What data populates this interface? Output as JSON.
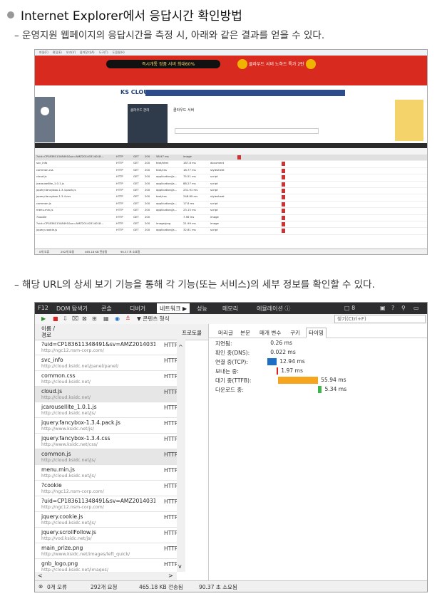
{
  "heading": "Internet Explorer에서 응답시간 확인방법",
  "desc1": "– 운영지원 웹페이지의 응답시간을 측정 시, 아래와 같은 결과를 얻을 수 있다.",
  "desc2": "– 해당 URL의 상세 보기 기능을 통해 각 기능(또는 서비스)의 세부 정보를 확인할 수 있다.",
  "shot1": {
    "banner_left": "즉시개통 정품 서버 최대60%",
    "banner_right": "클라우드 서버 노하드 특가 2탄",
    "logo": "KS CLOUD",
    "side_title": "클라우드 관리",
    "content_title": "클라우드 서버",
    "rows": [
      [
        "?uid=CP183611348491&sv=AMZ20140314018...",
        "HTTP",
        "GET",
        "200",
        "58.97 ms",
        "image"
      ],
      [
        "svc_info",
        "HTTP",
        "GET",
        "200",
        "text/html",
        "187.8 ms",
        "document"
      ],
      [
        "common.css",
        "HTTP",
        "GET",
        "200",
        "text/css",
        "18.77 ms",
        "stylesheet"
      ],
      [
        "cloud.js",
        "HTTP",
        "GET",
        "200",
        "application/ja...",
        "75.51 ms",
        "script"
      ],
      [
        "jcarousellite_1.0.1.js",
        "HTTP",
        "GET",
        "200",
        "application/ja...",
        "88.27 ms",
        "script"
      ],
      [
        "jquery.fancybox-1.3.4.pack.js",
        "HTTP",
        "GET",
        "200",
        "application/ja...",
        "231.91 ms",
        "script"
      ],
      [
        "jquery.fancybox-1.3.4.css",
        "HTTP",
        "GET",
        "200",
        "text/css",
        "248.89 ms",
        "stylesheet"
      ],
      [
        "common.js",
        "HTTP",
        "GET",
        "200",
        "application/ja...",
        "17.8 ms",
        "script"
      ],
      [
        "menu.min.js",
        "HTTP",
        "GET",
        "200",
        "application/ja...",
        "23.15 ms",
        "script"
      ],
      [
        "?cookie",
        "HTTP",
        "GET",
        "200",
        "",
        "7.56 ms",
        "image"
      ],
      [
        "?uid=CP183611348491&sv=AMZ20140314018...",
        "HTTP",
        "GET",
        "200",
        "image/png",
        "21.99 ms",
        "image"
      ],
      [
        "jquery.cookie.js",
        "HTTP",
        "GET",
        "200",
        "application/ja...",
        "32.81 ms",
        "script"
      ]
    ],
    "status": [
      "0개 오류",
      "292개 요청",
      "465.18 KB 전송됨",
      "90.37 초 소요됨"
    ]
  },
  "shot2": {
    "topbar": {
      "f12": "F12",
      "tabs": [
        "DOM 탐색기",
        "콘솔",
        "디버거",
        "네트워크 ▶",
        "성능",
        "메모리",
        "에뮬레이션 ⓘ"
      ],
      "device": "□ 8"
    },
    "toolbar": {
      "filter": "▼ 콘텐츠 형식",
      "search_placeholder": "찾기(Ctrl+F)"
    },
    "list_header": {
      "name": "이름 /",
      "path": "경로",
      "protocol": "프로토콜"
    },
    "rows": [
      {
        "name": "?uid=CP183611348491&sv=AMZ20140314018&url...",
        "url": "http://ngc12.nsm-corp.com/",
        "protocol": "HTTP"
      },
      {
        "name": "svc_info",
        "url": "http://cloud.ksidc.net/panel/panel/",
        "protocol": "HTTP"
      },
      {
        "name": "common.css",
        "url": "http://cloud.ksidc.net/",
        "protocol": "HTTP"
      },
      {
        "name": "cloud.js",
        "url": "http://cloud.ksidc.net/",
        "protocol": "HTTP"
      },
      {
        "name": "jcarousellite_1.0.1.js",
        "url": "http://cloud.ksidc.net/js/",
        "protocol": "HTTP"
      },
      {
        "name": "jquery.fancybox-1.3.4.pack.js",
        "url": "http://www.ksidc.net/js/",
        "protocol": "HTTP"
      },
      {
        "name": "jquery.fancybox-1.3.4.css",
        "url": "http://www.ksidc.net/css/",
        "protocol": "HTTP"
      },
      {
        "name": "common.js",
        "url": "http://cloud.ksidc.net/js/",
        "protocol": "HTTP"
      },
      {
        "name": "menu.min.js",
        "url": "http://cloud.ksidc.net/js/",
        "protocol": "HTTP"
      },
      {
        "name": "?cookie",
        "url": "http://ngc12.nsm-corp.com/",
        "protocol": "HTTP"
      },
      {
        "name": "?uid=CP183611348491&sv=AMZ20140314018&FCV...",
        "url": "http://ngc12.nsm-corp.com/",
        "protocol": "HTTP"
      },
      {
        "name": "jquery.cookie.js",
        "url": "http://cloud.ksidc.net/js/",
        "protocol": "HTTP"
      },
      {
        "name": "jquery.scrollFollow.js",
        "url": "http://vod.ksidc.net/js/",
        "protocol": "HTTP"
      },
      {
        "name": "main_prize.png",
        "url": "http://www.ksidc.net/images/left_quick/",
        "protocol": "HTTP"
      },
      {
        "name": "gnb_logo.png",
        "url": "http://cloud.ksidc.net/images/",
        "protocol": "HTTP"
      }
    ],
    "detail_tabs": [
      "머리글",
      "본문",
      "매개 변수",
      "쿠키",
      "타이밍"
    ],
    "timing": [
      {
        "label": "지연됨:",
        "value": "0.26 ms"
      },
      {
        "label": "확인 중(DNS):",
        "value": "0.022 ms"
      },
      {
        "label": "연결 중(TCP):",
        "value": "12.94 ms"
      },
      {
        "label": "보내는 중:",
        "value": "1.97 ms"
      },
      {
        "label": "대기 중(TTFB):",
        "value": "55.94 ms"
      },
      {
        "label": "다운로드 중:",
        "value": "5.34 ms"
      }
    ],
    "colors": {
      "tcp": "#1c6fc4",
      "send": "#d92020",
      "ttfb": "#f5a51e",
      "download": "#3db54a"
    },
    "status": [
      "0개 오류",
      "292개 요청",
      "465.18 KB 전송됨",
      "90.37 초 소요됨"
    ]
  }
}
